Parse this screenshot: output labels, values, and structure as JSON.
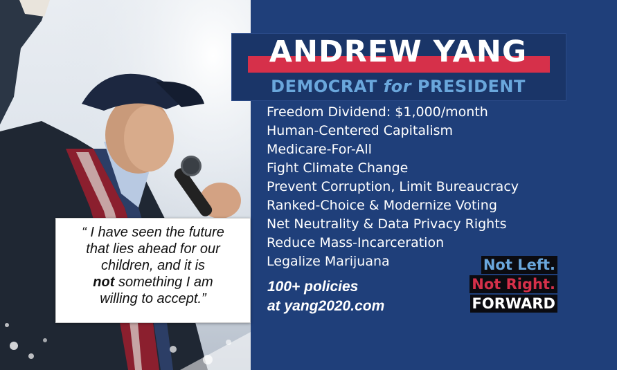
{
  "header": {
    "name": "ANDREW YANG",
    "subtitle_pre": "DEMOCRAT ",
    "subtitle_for": "for",
    "subtitle_post": " PRESIDENT"
  },
  "policies": [
    "Freedom Dividend: $1,000/month",
    "Human-Centered Capitalism",
    "Medicare-For-All",
    "Fight Climate Change",
    "Prevent Corruption, Limit Bureaucracy",
    "Ranked-Choice & Modernize Voting",
    "Net Neutrality & Data Privacy Rights",
    "Reduce Mass-Incarceration",
    "Legalize Marijuana"
  ],
  "more": {
    "line1": "100+ policies",
    "line2": "at yang2020.com"
  },
  "slogan": {
    "line1": "Not Left.",
    "line2": "Not Right.",
    "line3": "FORWARD"
  },
  "quote": {
    "line1": "“ I have seen the future",
    "line2": "that lies ahead for our",
    "line3": "children, and it is",
    "bold_word": "not",
    "line4_rest": " something I am",
    "line5": "willing to accept.”"
  },
  "colors": {
    "panel_blue": "#1f3f7a",
    "title_box": "#1a3568",
    "accent_red": "#d6304a",
    "accent_light_blue": "#6aa7dc"
  },
  "photo": {
    "description_icon": "candidate-photo"
  }
}
